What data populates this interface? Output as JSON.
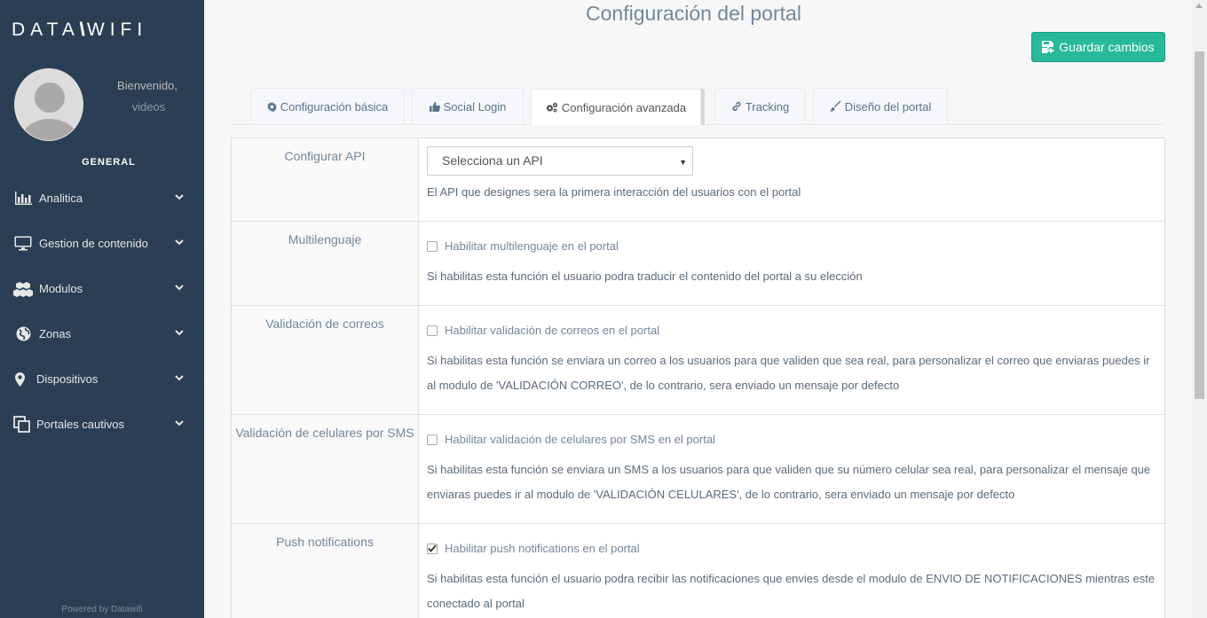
{
  "sidebar": {
    "logo_left": "DATA",
    "logo_slash": "\\\\\\",
    "logo_right": "WIFI",
    "welcome": "Bienvenido,",
    "username": "videos",
    "section_title": "GENERAL",
    "items": [
      {
        "label": "Analitica",
        "icon": "bar-chart-icon"
      },
      {
        "label": "Gestion de contenido",
        "icon": "desktop-icon"
      },
      {
        "label": "Modulos",
        "icon": "cubes-icon"
      },
      {
        "label": "Zonas",
        "icon": "globe-icon"
      },
      {
        "label": "Dispositivos",
        "icon": "map-marker-icon"
      },
      {
        "label": "Portales cautivos",
        "icon": "clone-icon"
      }
    ],
    "powered": "Powered by Datawifi"
  },
  "header": {
    "title": "Configuración del portal",
    "save_label": "Guardar cambios"
  },
  "tabs": [
    {
      "label": "Configuración básica",
      "icon": "gear-icon",
      "active": false
    },
    {
      "label": "Social Login",
      "icon": "thumbs-up-icon",
      "active": false
    },
    {
      "label": "Configuración avanzada",
      "icon": "gears-icon",
      "active": true
    },
    {
      "label": "Tracking",
      "icon": "link-icon",
      "active": false
    },
    {
      "label": "Diseño del portal",
      "icon": "paint-brush-icon",
      "active": false
    }
  ],
  "settings": {
    "api": {
      "label": "Configurar API",
      "select_value": "Selecciona un API",
      "desc": "El API que designes sera la primera interacción del usuarios con el portal"
    },
    "multilenguaje": {
      "label": "Multilenguaje",
      "check_label": "Habilitar multilenguaje en el portal",
      "checked": false,
      "desc": "Si habilitas esta función el usuario podra traducir el contenido del portal a su elección"
    },
    "correos": {
      "label": "Validación de correos",
      "check_label": "Habilitar validación de correos en el portal",
      "checked": false,
      "desc": "Si habilitas esta función se enviara un correo a los usuarios para que validen que sea real, para personalizar el correo que enviaras puedes ir al modulo de 'VALIDACIÓN CORREO', de lo contrario, sera enviado un mensaje por defecto"
    },
    "celulares": {
      "label": "Validación de celulares por SMS",
      "check_label": "Habilitar validación de celulares por SMS en el portal",
      "checked": false,
      "desc": "Si habilitas esta función se enviara un SMS a los usuarios para que validen que su número celular sea real, para personalizar el mensaje que enviaras puedes ir al modulo de 'VALIDACIÓN CELULARES', de lo contrario, sera enviado un mensaje por defecto"
    },
    "push": {
      "label": "Push notifications",
      "check_label": "Habilitar push notifications en el portal",
      "checked": true,
      "desc": "Si habilitas esta función el usuario podra recibir las notificaciones que envies desde el modulo de ENVIO DE NOTIFICACIONES mientras este conectado al portal"
    }
  },
  "colors": {
    "sidebar_bg": "#2a3f54",
    "accent_green": "#26b99a"
  }
}
